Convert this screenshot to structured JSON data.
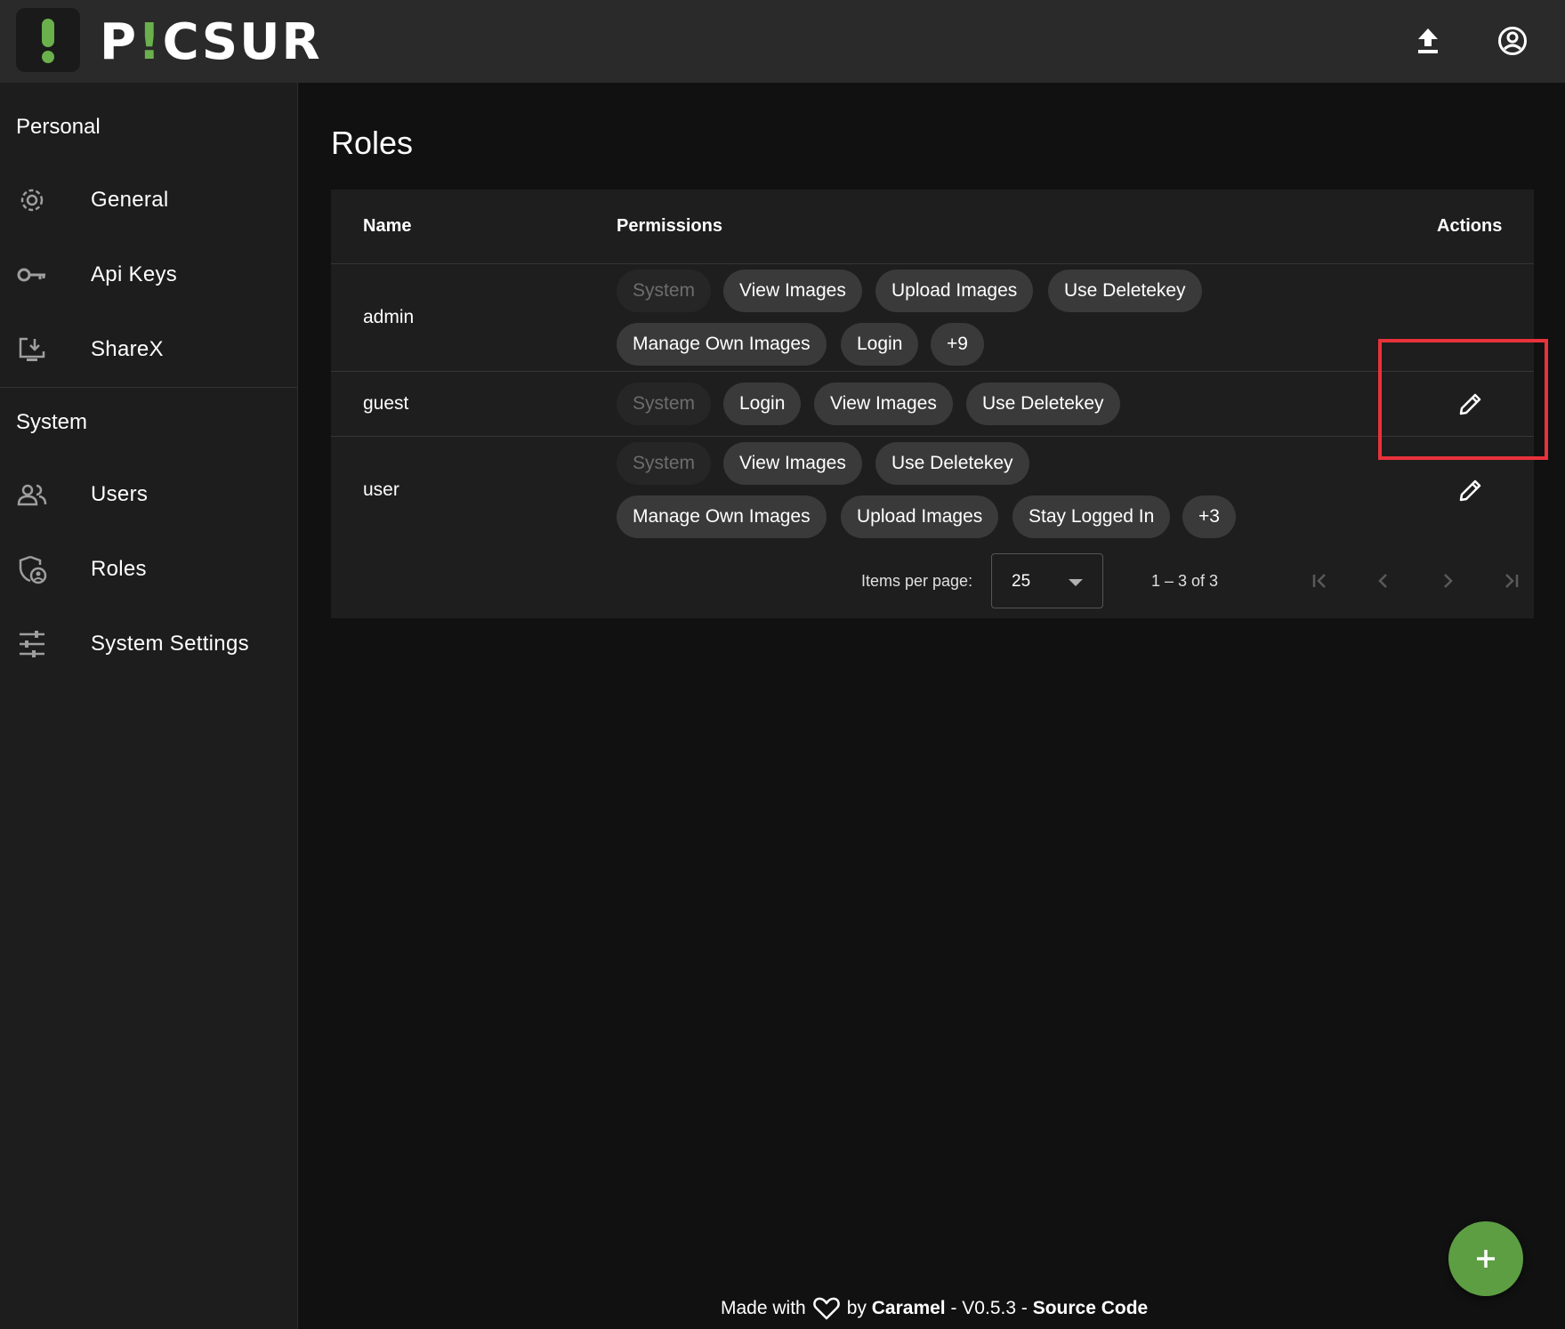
{
  "app": {
    "logo_text_pre": "P",
    "logo_text_bang": "!",
    "logo_text_post": "CSUR"
  },
  "topbar": {
    "upload_icon": "upload-icon",
    "account_icon": "account-circle-icon"
  },
  "sidebar": {
    "sections": [
      {
        "title": "Personal",
        "items": [
          {
            "label": "General",
            "icon": "gear-icon"
          },
          {
            "label": "Api Keys",
            "icon": "key-icon"
          },
          {
            "label": "ShareX",
            "icon": "download-to-screen-icon"
          }
        ]
      },
      {
        "title": "System",
        "items": [
          {
            "label": "Users",
            "icon": "users-icon"
          },
          {
            "label": "Roles",
            "icon": "shield-user-icon"
          },
          {
            "label": "System Settings",
            "icon": "tune-sliders-icon"
          }
        ]
      }
    ]
  },
  "main": {
    "title": "Roles",
    "table": {
      "headers": {
        "name": "Name",
        "permissions": "Permissions",
        "actions": "Actions"
      },
      "rows": [
        {
          "name": "admin",
          "chips_line1": [
            "System",
            "View Images",
            "Upload Images",
            "Use Deletekey"
          ],
          "chips_line2": [
            "Manage Own Images",
            "Login",
            "+9"
          ],
          "editable": false
        },
        {
          "name": "guest",
          "chips_line1": [
            "System",
            "Login",
            "View Images",
            "Use Deletekey"
          ],
          "chips_line2": [],
          "editable": true
        },
        {
          "name": "user",
          "chips_line1": [
            "System",
            "View Images",
            "Use Deletekey"
          ],
          "chips_line2": [
            "Manage Own Images",
            "Upload Images",
            "Stay Logged In",
            "+3"
          ],
          "editable": true
        }
      ]
    },
    "paginator": {
      "items_per_page_label": "Items per page:",
      "items_per_page_value": "25",
      "range_label": "1 – 3 of 3"
    }
  },
  "fab": {
    "icon": "plus-icon"
  },
  "footer": {
    "made_with": "Made with",
    "by": "by",
    "author": "Caramel",
    "separator1": " - V0.5.3 - ",
    "source": "Source Code"
  },
  "colors": {
    "accent": "#6ab04c",
    "fab": "#5d9e43",
    "highlight": "#e8323c"
  }
}
